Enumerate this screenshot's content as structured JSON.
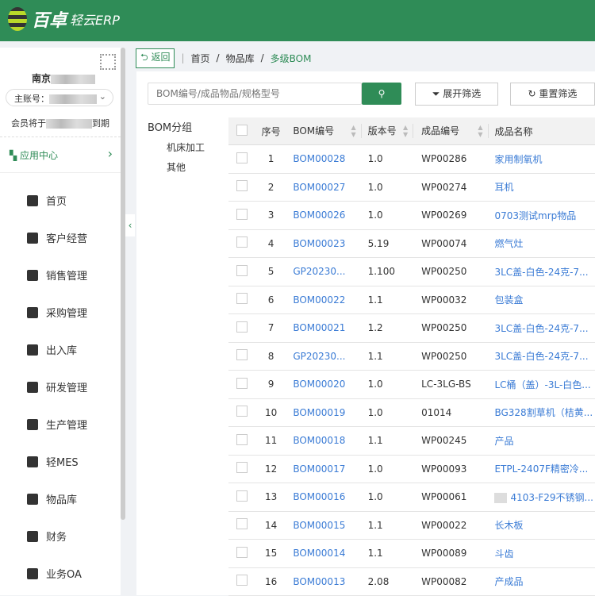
{
  "app": {
    "brand": "百卓",
    "sub": "轻云ERP"
  },
  "sidebar": {
    "company": "南京",
    "account_label": "主账号：",
    "expire_prefix": "会员将于",
    "expire_suffix": "到期",
    "app_center": "应用中心",
    "items": [
      {
        "label": "首页",
        "icon": "home-icon"
      },
      {
        "label": "客户经营",
        "icon": "user-icon"
      },
      {
        "label": "销售管理",
        "icon": "document-icon"
      },
      {
        "label": "采购管理",
        "icon": "cart-icon"
      },
      {
        "label": "出入库",
        "icon": "warehouse-icon"
      },
      {
        "label": "研发管理",
        "icon": "layers-icon"
      },
      {
        "label": "生产管理",
        "icon": "factory-icon"
      },
      {
        "label": "轻MES",
        "icon": "mes-icon"
      },
      {
        "label": "物品库",
        "icon": "boxes-icon"
      },
      {
        "label": "财务",
        "icon": "yen-icon"
      },
      {
        "label": "业务OA",
        "icon": "grid-icon"
      }
    ]
  },
  "breadcrumb": {
    "back": "返回",
    "items": [
      "首页",
      "物品库",
      "多级BOM"
    ]
  },
  "search": {
    "placeholder": "BOM编号/成品物品/规格型号"
  },
  "buttons": {
    "expand_filter": "展开筛选",
    "reset_filter": "重置筛选"
  },
  "tree": {
    "title": "BOM分组",
    "items": [
      "机床加工",
      "其他"
    ]
  },
  "table": {
    "headers": [
      "序号",
      "BOM编号",
      "版本号",
      "成品编号",
      "成品名称"
    ],
    "rows": [
      [
        "1",
        "BOM00028",
        "1.0",
        "WP00286",
        "家用制氧机"
      ],
      [
        "2",
        "BOM00027",
        "1.0",
        "WP00274",
        "耳机"
      ],
      [
        "3",
        "BOM00026",
        "1.0",
        "WP00269",
        "0703测试mrp物品"
      ],
      [
        "4",
        "BOM00023",
        "5.19",
        "WP00074",
        "燃气灶"
      ],
      [
        "5",
        "GP20230...",
        "1.100",
        "WP00250",
        "3LC盖-白色-24克-7..."
      ],
      [
        "6",
        "BOM00022",
        "1.1",
        "WP00032",
        "包装盒"
      ],
      [
        "7",
        "BOM00021",
        "1.2",
        "WP00250",
        "3LC盖-白色-24克-7..."
      ],
      [
        "8",
        "GP20230...",
        "1.1",
        "WP00250",
        "3LC盖-白色-24克-7..."
      ],
      [
        "9",
        "BOM00020",
        "1.0",
        "LC-3LG-BS",
        "LC桶（盖）-3L-白色..."
      ],
      [
        "10",
        "BOM00019",
        "1.0",
        "01014",
        "BG328割草机（桔黄..."
      ],
      [
        "11",
        "BOM00018",
        "1.1",
        "WP00245",
        "产品"
      ],
      [
        "12",
        "BOM00017",
        "1.0",
        "WP00093",
        "ETPL-2407F精密冷..."
      ],
      [
        "13",
        "BOM00016",
        "1.0",
        "WP00061",
        "4103-F29不锈钢..."
      ],
      [
        "14",
        "BOM00015",
        "1.1",
        "WP00022",
        "长木板"
      ],
      [
        "15",
        "BOM00014",
        "1.1",
        "WP00089",
        "斗齿"
      ],
      [
        "16",
        "BOM00013",
        "2.08",
        "WP00082",
        "产成品"
      ]
    ]
  },
  "colors": {
    "brand": "#2f8c57",
    "link": "#3a7bd5"
  }
}
